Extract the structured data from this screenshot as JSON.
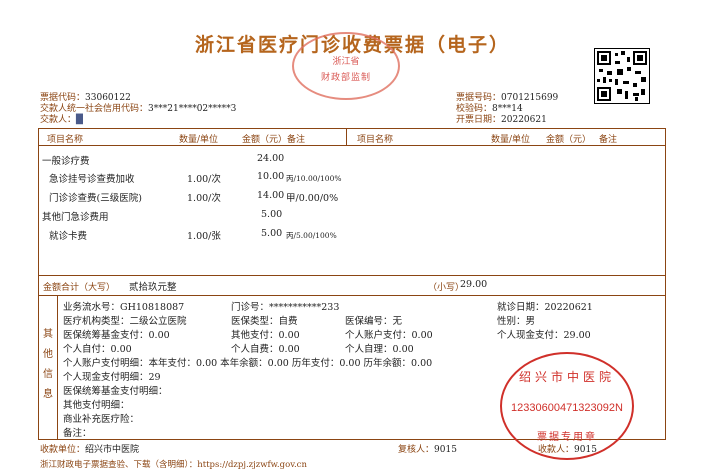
{
  "title": "浙江省医疗门诊收费票据（电子）",
  "top_stamp": {
    "line1": "浙江省",
    "arc": "监制",
    "bottom": "财政部监制"
  },
  "left_meta": {
    "code_label": "票据代码：",
    "code_value": "33060122",
    "credit_label": "交款人统一社会信用代码：",
    "credit_value": "3***21****02*****3",
    "payer_label": "交款人：",
    "payer_value": "█"
  },
  "right_meta": {
    "number_label": "票据号码：",
    "number_value": "0701215699",
    "check_label": "校验码：",
    "check_value": "8***14",
    "date_label": "开票日期：",
    "date_value": "20220621"
  },
  "columns": {
    "item": "项目名称",
    "qty": "数量/单位",
    "amount": "金额（元）",
    "remark": "备注",
    "item2": "项目名称",
    "qty2": "数量/单位",
    "amount2": "金额（元）",
    "remark2": "备注"
  },
  "items": [
    {
      "name": "一般诊疗费",
      "qty": "",
      "amount": "24.00",
      "remark": ""
    },
    {
      "name": "急诊挂号诊查费加收",
      "qty": "1.00/次",
      "amount": "10.00",
      "remark": "丙/10.00/100%"
    },
    {
      "name": "门诊诊查费(三级医院)",
      "qty": "1.00/次",
      "amount": "14.00",
      "remark": "甲/0.00/0%"
    },
    {
      "name": "其他门急诊费用",
      "qty": "",
      "amount": "5.00",
      "remark": ""
    },
    {
      "name": "就诊卡费",
      "qty": "1.00/张",
      "amount": "5.00",
      "remark": "丙/5.00/100%"
    }
  ],
  "total": {
    "upper_label": "金额合计（大写）",
    "upper_value": "贰拾玖元整",
    "lower_label": "（小写）",
    "lower_value": "29.00"
  },
  "other_info": {
    "side_label": [
      "其",
      "他",
      "信",
      "息"
    ],
    "serial": "业务流水号：GH10818087",
    "outpatient": "门诊号：***********233",
    "visit_date": "就诊日期：20220621",
    "org_type": "医疗机构类型：二级公立医院",
    "insurance_type": "医保类型：自费",
    "insurance_no": "医保编号：无",
    "gender": "性别：男",
    "pool_pay": "医保统筹基金支付：0.00",
    "other_pay": "其他支付：0.00",
    "account_pay": "个人账户支付：0.00",
    "self_pay_total": "个人现金支付：29.00",
    "self_burden": "个人自付：0.00",
    "self_expense": "个人自费：0.00",
    "self_care": "个人自理：0.00",
    "account_detail": "个人账户支付明细：本年支付：0.00 本年余额：0.00 历年支付：0.00 历年余额：0.00",
    "cash_detail": "个人现金支付明细：29",
    "pool_detail": "医保统筹基金支付明细：",
    "other_detail": "其他支付明细：",
    "commercial": "商业补充医疗险：",
    "note": "备注："
  },
  "red_stamp": {
    "top": "绍兴市中医院",
    "number": "12330600471323092N",
    "bottom": "票据专用章"
  },
  "footer": {
    "unit_label": "收款单位：",
    "unit_value": "绍兴市中医院",
    "reviewer_label": "复核人：",
    "reviewer_value": "9015",
    "collector_label": "收款人：",
    "collector_value": "9015",
    "query": "浙江财政电子票据查验、下载（含明细）：https://dzpj.zjzwfw.gov.cn"
  }
}
